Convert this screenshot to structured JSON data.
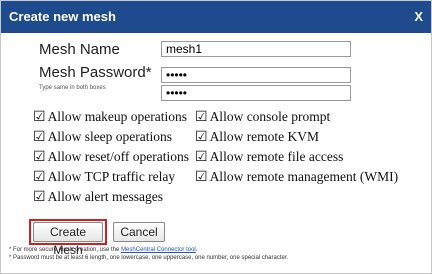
{
  "dialog": {
    "title": "Create new mesh",
    "close_label": "X"
  },
  "form": {
    "mesh_name_label": "Mesh Name",
    "mesh_name_value": "mesh1",
    "mesh_password_label": "Mesh Password*",
    "password_hint": "Type same in both boxes",
    "password_value": "•••••",
    "password_confirm_value": "•••••"
  },
  "options": [
    {
      "label": "Allow makeup operations",
      "checked": true
    },
    {
      "label": "Allow console prompt",
      "checked": true
    },
    {
      "label": "Allow sleep operations",
      "checked": true
    },
    {
      "label": "Allow remote KVM",
      "checked": true
    },
    {
      "label": "Allow reset/off operations",
      "checked": true
    },
    {
      "label": "Allow remote file access",
      "checked": true
    },
    {
      "label": "Allow TCP traffic relay",
      "checked": true
    },
    {
      "label": "Allow remote management (WMI)",
      "checked": true
    },
    {
      "label": "Allow alert messages",
      "checked": true
    }
  ],
  "buttons": {
    "create_label": "Create Mesh",
    "cancel_label": "Cancel"
  },
  "footer": {
    "note1_prefix": "* For more secure mesh creation, use the ",
    "note1_link": "MeshCentral Connector tool",
    "note1_suffix": ".",
    "note2": "* Password must be at least 6 length, one lowercase, one uppercase, one number, one special character."
  },
  "colors": {
    "titlebar": "#1e4a8e",
    "highlight": "#d02020",
    "link": "#1a56c4"
  }
}
